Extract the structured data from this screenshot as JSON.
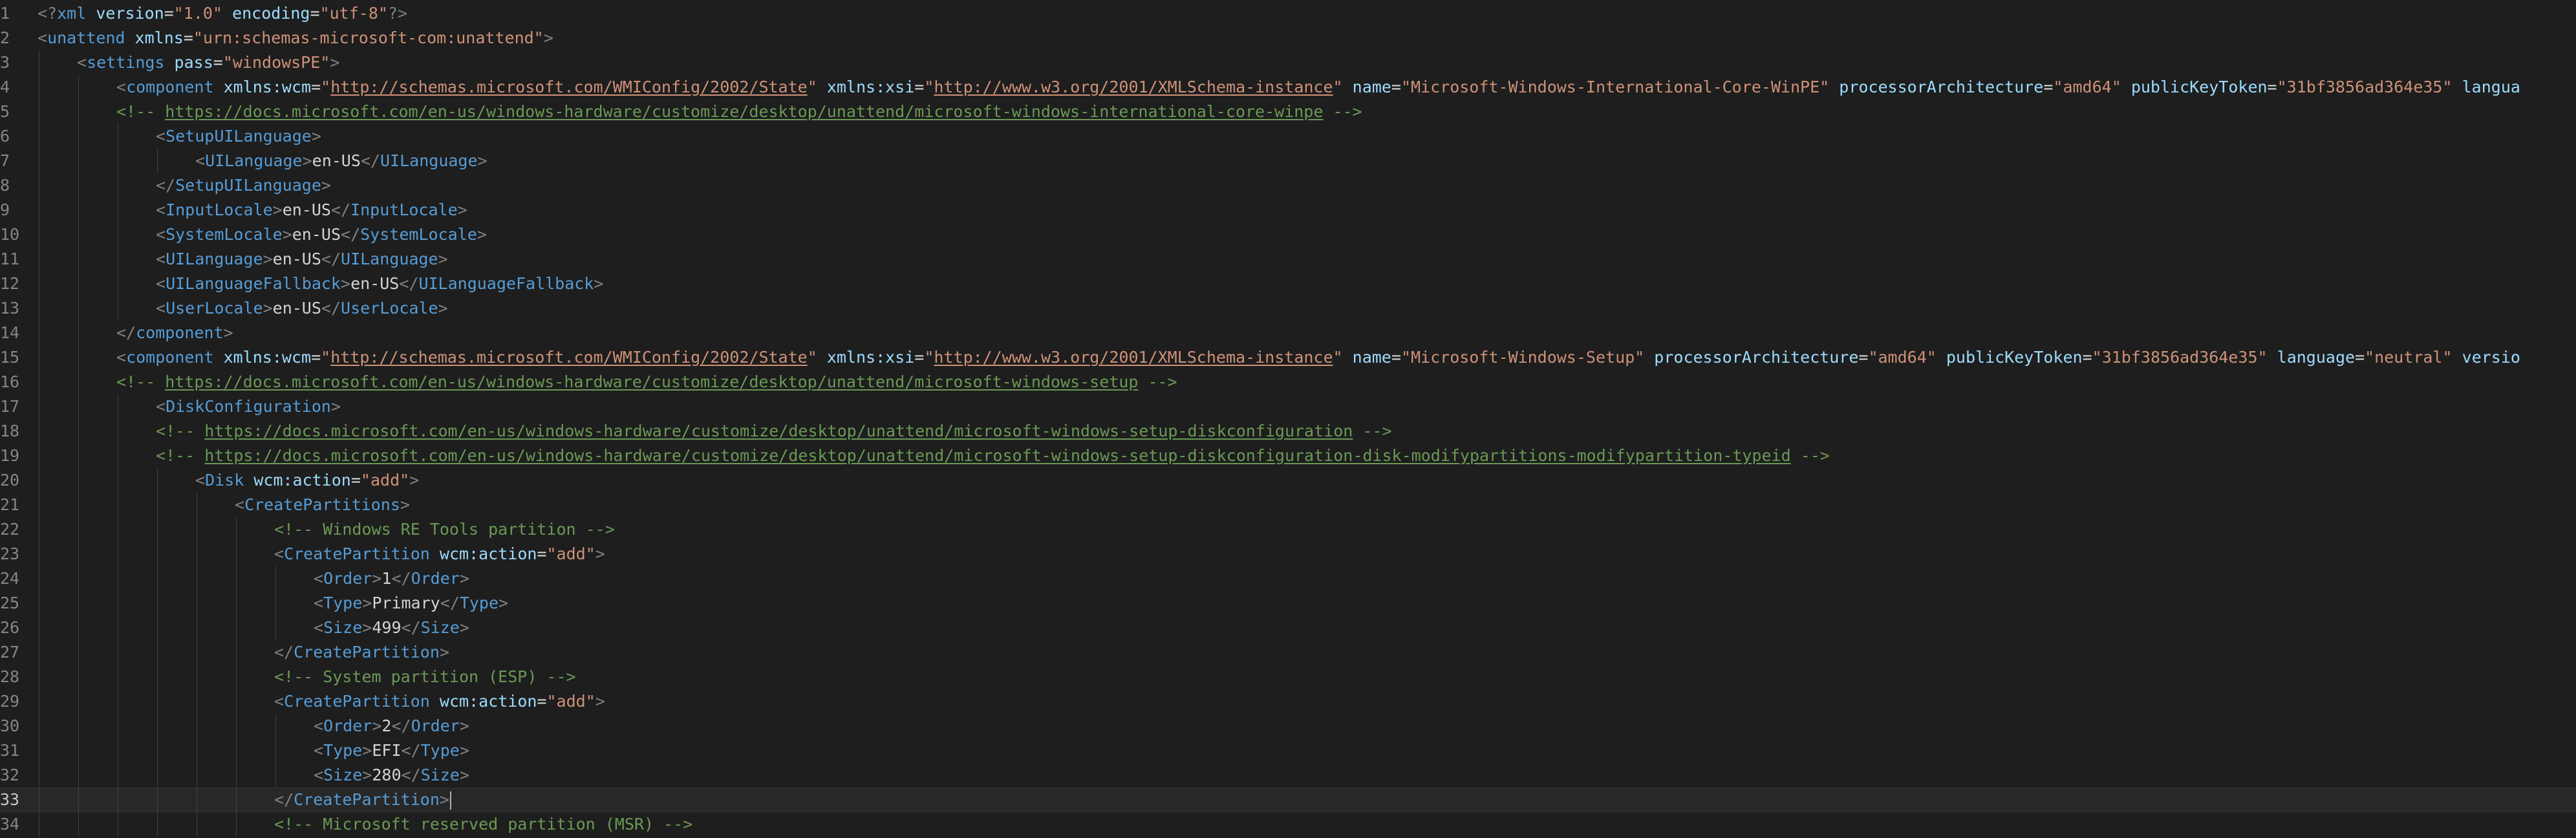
{
  "editor": {
    "language": "xml",
    "current_line": 33,
    "theme": {
      "background": "#1e1e1e",
      "tag": "#569cd6",
      "attribute": "#9cdcfe",
      "string": "#ce9178",
      "comment": "#6a9955",
      "punctuation": "#808080",
      "text": "#d4d4d4",
      "line_number": "#858585"
    },
    "lines": [
      {
        "num": "1",
        "indent": 0,
        "tokens": [
          [
            "punct",
            "<?"
          ],
          [
            "tag",
            "xml"
          ],
          [
            "text",
            " "
          ],
          [
            "attr",
            "version"
          ],
          [
            "text",
            "="
          ],
          [
            "str",
            "\"1.0\""
          ],
          [
            "text",
            " "
          ],
          [
            "attr",
            "encoding"
          ],
          [
            "text",
            "="
          ],
          [
            "str",
            "\"utf-8\""
          ],
          [
            "punct",
            "?>"
          ]
        ]
      },
      {
        "num": "2",
        "indent": 0,
        "tokens": [
          [
            "punct",
            "<"
          ],
          [
            "tag",
            "unattend"
          ],
          [
            "text",
            " "
          ],
          [
            "attr",
            "xmlns"
          ],
          [
            "text",
            "="
          ],
          [
            "str",
            "\"urn:schemas-microsoft-com:unattend\""
          ],
          [
            "punct",
            ">"
          ]
        ]
      },
      {
        "num": "3",
        "indent": 1,
        "tokens": [
          [
            "punct",
            "<"
          ],
          [
            "tag",
            "settings"
          ],
          [
            "text",
            " "
          ],
          [
            "attr",
            "pass"
          ],
          [
            "text",
            "="
          ],
          [
            "str",
            "\"windowsPE\""
          ],
          [
            "punct",
            ">"
          ]
        ]
      },
      {
        "num": "4",
        "indent": 2,
        "tokens": [
          [
            "punct",
            "<"
          ],
          [
            "tag",
            "component"
          ],
          [
            "text",
            " "
          ],
          [
            "attr",
            "xmlns:wcm"
          ],
          [
            "text",
            "="
          ],
          [
            "str",
            "\""
          ],
          [
            "strlink",
            "http://schemas.microsoft.com/WMIConfig/2002/State"
          ],
          [
            "str",
            "\""
          ],
          [
            "text",
            " "
          ],
          [
            "attr",
            "xmlns:xsi"
          ],
          [
            "text",
            "="
          ],
          [
            "str",
            "\""
          ],
          [
            "strlink",
            "http://www.w3.org/2001/XMLSchema-instance"
          ],
          [
            "str",
            "\""
          ],
          [
            "text",
            " "
          ],
          [
            "attr",
            "name"
          ],
          [
            "text",
            "="
          ],
          [
            "str",
            "\"Microsoft-Windows-International-Core-WinPE\""
          ],
          [
            "text",
            " "
          ],
          [
            "attr",
            "processorArchitecture"
          ],
          [
            "text",
            "="
          ],
          [
            "str",
            "\"amd64\""
          ],
          [
            "text",
            " "
          ],
          [
            "attr",
            "publicKeyToken"
          ],
          [
            "text",
            "="
          ],
          [
            "str",
            "\"31bf3856ad364e35\""
          ],
          [
            "text",
            " "
          ],
          [
            "attr",
            "langua"
          ]
        ]
      },
      {
        "num": "5",
        "indent": 2,
        "tokens": [
          [
            "com",
            "<!-- "
          ],
          [
            "link",
            "https://docs.microsoft.com/en-us/windows-hardware/customize/desktop/unattend/microsoft-windows-international-core-winpe"
          ],
          [
            "com",
            " -->"
          ]
        ]
      },
      {
        "num": "6",
        "indent": 3,
        "tokens": [
          [
            "punct",
            "<"
          ],
          [
            "tag",
            "SetupUILanguage"
          ],
          [
            "punct",
            ">"
          ]
        ]
      },
      {
        "num": "7",
        "indent": 4,
        "tokens": [
          [
            "punct",
            "<"
          ],
          [
            "tag",
            "UILanguage"
          ],
          [
            "punct",
            ">"
          ],
          [
            "text",
            "en-US"
          ],
          [
            "punct",
            "</"
          ],
          [
            "tag",
            "UILanguage"
          ],
          [
            "punct",
            ">"
          ]
        ]
      },
      {
        "num": "8",
        "indent": 3,
        "tokens": [
          [
            "punct",
            "</"
          ],
          [
            "tag",
            "SetupUILanguage"
          ],
          [
            "punct",
            ">"
          ]
        ]
      },
      {
        "num": "9",
        "indent": 3,
        "tokens": [
          [
            "punct",
            "<"
          ],
          [
            "tag",
            "InputLocale"
          ],
          [
            "punct",
            ">"
          ],
          [
            "text",
            "en-US"
          ],
          [
            "punct",
            "</"
          ],
          [
            "tag",
            "InputLocale"
          ],
          [
            "punct",
            ">"
          ]
        ]
      },
      {
        "num": "10",
        "indent": 3,
        "tokens": [
          [
            "punct",
            "<"
          ],
          [
            "tag",
            "SystemLocale"
          ],
          [
            "punct",
            ">"
          ],
          [
            "text",
            "en-US"
          ],
          [
            "punct",
            "</"
          ],
          [
            "tag",
            "SystemLocale"
          ],
          [
            "punct",
            ">"
          ]
        ]
      },
      {
        "num": "11",
        "indent": 3,
        "tokens": [
          [
            "punct",
            "<"
          ],
          [
            "tag",
            "UILanguage"
          ],
          [
            "punct",
            ">"
          ],
          [
            "text",
            "en-US"
          ],
          [
            "punct",
            "</"
          ],
          [
            "tag",
            "UILanguage"
          ],
          [
            "punct",
            ">"
          ]
        ]
      },
      {
        "num": "12",
        "indent": 3,
        "tokens": [
          [
            "punct",
            "<"
          ],
          [
            "tag",
            "UILanguageFallback"
          ],
          [
            "punct",
            ">"
          ],
          [
            "text",
            "en-US"
          ],
          [
            "punct",
            "</"
          ],
          [
            "tag",
            "UILanguageFallback"
          ],
          [
            "punct",
            ">"
          ]
        ]
      },
      {
        "num": "13",
        "indent": 3,
        "tokens": [
          [
            "punct",
            "<"
          ],
          [
            "tag",
            "UserLocale"
          ],
          [
            "punct",
            ">"
          ],
          [
            "text",
            "en-US"
          ],
          [
            "punct",
            "</"
          ],
          [
            "tag",
            "UserLocale"
          ],
          [
            "punct",
            ">"
          ]
        ]
      },
      {
        "num": "14",
        "indent": 2,
        "tokens": [
          [
            "punct",
            "</"
          ],
          [
            "tag",
            "component"
          ],
          [
            "punct",
            ">"
          ]
        ]
      },
      {
        "num": "15",
        "indent": 2,
        "tokens": [
          [
            "punct",
            "<"
          ],
          [
            "tag",
            "component"
          ],
          [
            "text",
            " "
          ],
          [
            "attr",
            "xmlns:wcm"
          ],
          [
            "text",
            "="
          ],
          [
            "str",
            "\""
          ],
          [
            "strlink",
            "http://schemas.microsoft.com/WMIConfig/2002/State"
          ],
          [
            "str",
            "\""
          ],
          [
            "text",
            " "
          ],
          [
            "attr",
            "xmlns:xsi"
          ],
          [
            "text",
            "="
          ],
          [
            "str",
            "\""
          ],
          [
            "strlink",
            "http://www.w3.org/2001/XMLSchema-instance"
          ],
          [
            "str",
            "\""
          ],
          [
            "text",
            " "
          ],
          [
            "attr",
            "name"
          ],
          [
            "text",
            "="
          ],
          [
            "str",
            "\"Microsoft-Windows-Setup\""
          ],
          [
            "text",
            " "
          ],
          [
            "attr",
            "processorArchitecture"
          ],
          [
            "text",
            "="
          ],
          [
            "str",
            "\"amd64\""
          ],
          [
            "text",
            " "
          ],
          [
            "attr",
            "publicKeyToken"
          ],
          [
            "text",
            "="
          ],
          [
            "str",
            "\"31bf3856ad364e35\""
          ],
          [
            "text",
            " "
          ],
          [
            "attr",
            "language"
          ],
          [
            "text",
            "="
          ],
          [
            "str",
            "\"neutral\""
          ],
          [
            "text",
            " "
          ],
          [
            "attr",
            "versio"
          ]
        ]
      },
      {
        "num": "16",
        "indent": 2,
        "tokens": [
          [
            "com",
            "<!-- "
          ],
          [
            "link",
            "https://docs.microsoft.com/en-us/windows-hardware/customize/desktop/unattend/microsoft-windows-setup"
          ],
          [
            "com",
            " -->"
          ]
        ]
      },
      {
        "num": "17",
        "indent": 3,
        "tokens": [
          [
            "punct",
            "<"
          ],
          [
            "tag",
            "DiskConfiguration"
          ],
          [
            "punct",
            ">"
          ]
        ]
      },
      {
        "num": "18",
        "indent": 3,
        "tokens": [
          [
            "com",
            "<!-- "
          ],
          [
            "link",
            "https://docs.microsoft.com/en-us/windows-hardware/customize/desktop/unattend/microsoft-windows-setup-diskconfiguration"
          ],
          [
            "com",
            " -->"
          ]
        ]
      },
      {
        "num": "19",
        "indent": 3,
        "tokens": [
          [
            "com",
            "<!-- "
          ],
          [
            "link",
            "https://docs.microsoft.com/en-us/windows-hardware/customize/desktop/unattend/microsoft-windows-setup-diskconfiguration-disk-modifypartitions-modifypartition-typeid"
          ],
          [
            "com",
            " -->"
          ]
        ]
      },
      {
        "num": "20",
        "indent": 4,
        "tokens": [
          [
            "punct",
            "<"
          ],
          [
            "tag",
            "Disk"
          ],
          [
            "text",
            " "
          ],
          [
            "attr",
            "wcm:action"
          ],
          [
            "text",
            "="
          ],
          [
            "str",
            "\"add\""
          ],
          [
            "punct",
            ">"
          ]
        ]
      },
      {
        "num": "21",
        "indent": 5,
        "tokens": [
          [
            "punct",
            "<"
          ],
          [
            "tag",
            "CreatePartitions"
          ],
          [
            "punct",
            ">"
          ]
        ]
      },
      {
        "num": "22",
        "indent": 6,
        "tokens": [
          [
            "com",
            "<!-- Windows RE Tools partition -->"
          ]
        ]
      },
      {
        "num": "23",
        "indent": 6,
        "tokens": [
          [
            "punct",
            "<"
          ],
          [
            "tag",
            "CreatePartition"
          ],
          [
            "text",
            " "
          ],
          [
            "attr",
            "wcm:action"
          ],
          [
            "text",
            "="
          ],
          [
            "str",
            "\"add\""
          ],
          [
            "punct",
            ">"
          ]
        ]
      },
      {
        "num": "24",
        "indent": 7,
        "tokens": [
          [
            "punct",
            "<"
          ],
          [
            "tag",
            "Order"
          ],
          [
            "punct",
            ">"
          ],
          [
            "text",
            "1"
          ],
          [
            "punct",
            "</"
          ],
          [
            "tag",
            "Order"
          ],
          [
            "punct",
            ">"
          ]
        ]
      },
      {
        "num": "25",
        "indent": 7,
        "tokens": [
          [
            "punct",
            "<"
          ],
          [
            "tag",
            "Type"
          ],
          [
            "punct",
            ">"
          ],
          [
            "text",
            "Primary"
          ],
          [
            "punct",
            "</"
          ],
          [
            "tag",
            "Type"
          ],
          [
            "punct",
            ">"
          ]
        ]
      },
      {
        "num": "26",
        "indent": 7,
        "tokens": [
          [
            "punct",
            "<"
          ],
          [
            "tag",
            "Size"
          ],
          [
            "punct",
            ">"
          ],
          [
            "text",
            "499"
          ],
          [
            "punct",
            "</"
          ],
          [
            "tag",
            "Size"
          ],
          [
            "punct",
            ">"
          ]
        ]
      },
      {
        "num": "27",
        "indent": 6,
        "tokens": [
          [
            "punct",
            "</"
          ],
          [
            "tag",
            "CreatePartition"
          ],
          [
            "punct",
            ">"
          ]
        ]
      },
      {
        "num": "28",
        "indent": 6,
        "tokens": [
          [
            "com",
            "<!-- System partition (ESP) -->"
          ]
        ]
      },
      {
        "num": "29",
        "indent": 6,
        "tokens": [
          [
            "punct",
            "<"
          ],
          [
            "tag",
            "CreatePartition"
          ],
          [
            "text",
            " "
          ],
          [
            "attr",
            "wcm:action"
          ],
          [
            "text",
            "="
          ],
          [
            "str",
            "\"add\""
          ],
          [
            "punct",
            ">"
          ]
        ]
      },
      {
        "num": "30",
        "indent": 7,
        "tokens": [
          [
            "punct",
            "<"
          ],
          [
            "tag",
            "Order"
          ],
          [
            "punct",
            ">"
          ],
          [
            "text",
            "2"
          ],
          [
            "punct",
            "</"
          ],
          [
            "tag",
            "Order"
          ],
          [
            "punct",
            ">"
          ]
        ]
      },
      {
        "num": "31",
        "indent": 7,
        "tokens": [
          [
            "punct",
            "<"
          ],
          [
            "tag",
            "Type"
          ],
          [
            "punct",
            ">"
          ],
          [
            "text",
            "EFI"
          ],
          [
            "punct",
            "</"
          ],
          [
            "tag",
            "Type"
          ],
          [
            "punct",
            ">"
          ]
        ]
      },
      {
        "num": "32",
        "indent": 7,
        "tokens": [
          [
            "punct",
            "<"
          ],
          [
            "tag",
            "Size"
          ],
          [
            "punct",
            ">"
          ],
          [
            "text",
            "280"
          ],
          [
            "punct",
            "</"
          ],
          [
            "tag",
            "Size"
          ],
          [
            "punct",
            ">"
          ]
        ]
      },
      {
        "num": "33",
        "indent": 6,
        "tokens": [
          [
            "punct",
            "</"
          ],
          [
            "tag",
            "CreatePartition"
          ],
          [
            "punct",
            ">"
          ],
          [
            "caret",
            ""
          ]
        ]
      },
      {
        "num": "34",
        "indent": 6,
        "tokens": [
          [
            "com",
            "<!-- Microsoft reserved partition (MSR) -->"
          ]
        ]
      }
    ]
  }
}
